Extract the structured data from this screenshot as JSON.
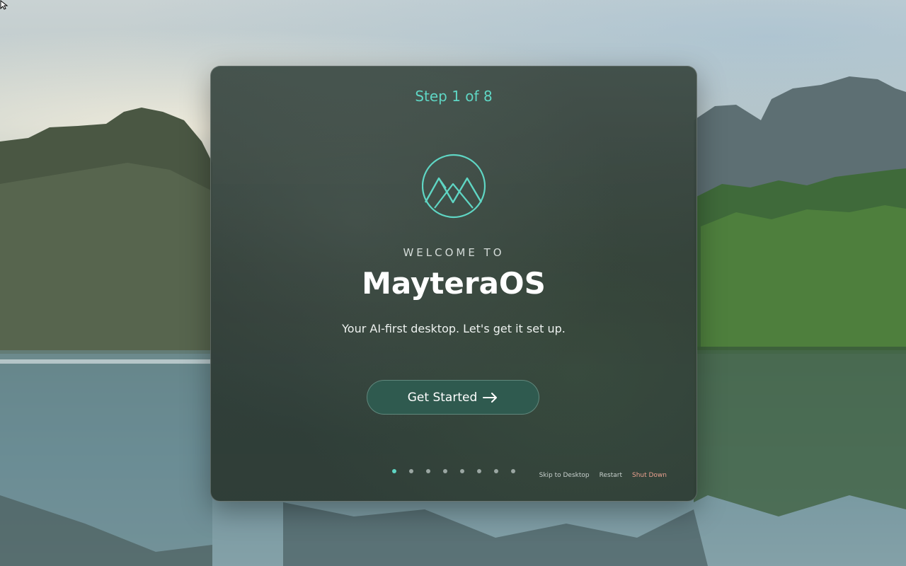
{
  "wizard": {
    "step_label": "Step 1 of 8",
    "welcome_label": "WELCOME TO",
    "title": "MayteraOS",
    "subtitle": "Your AI-first desktop. Let's get it set up.",
    "get_started_label": "Get Started",
    "total_steps": 8,
    "current_step": 1
  },
  "footer": {
    "skip_label": "Skip to Desktop",
    "restart_label": "Restart",
    "shutdown_label": "Shut Down"
  },
  "colors": {
    "accent": "#5fd6c4",
    "button": "#2f5a4f",
    "shutdown": "#e9a08e"
  },
  "icons": {
    "logo": "maytera-mountain-logo",
    "arrow": "arrow-right-icon",
    "cursor": "mouse-pointer"
  }
}
